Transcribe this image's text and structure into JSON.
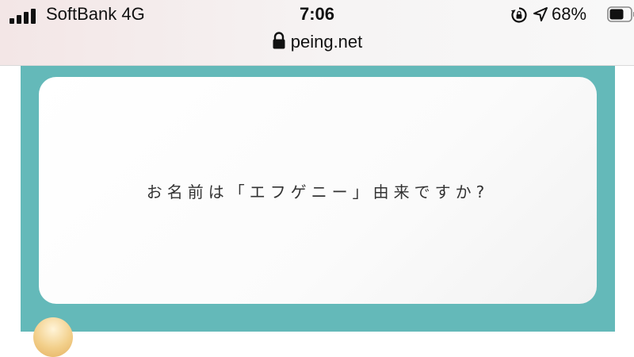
{
  "status_bar": {
    "carrier": "SoftBank 4G",
    "time": "7:06",
    "battery_percent": "68%",
    "battery_level": 0.68,
    "icons": [
      "signal-bars-icon",
      "rotation-lock-icon",
      "location-arrow-icon",
      "battery-icon"
    ]
  },
  "address_bar": {
    "url": "peing.net",
    "icon": "lock-icon"
  },
  "question": {
    "text": "お名前は「エフゲニー」由来ですか?"
  },
  "colors": {
    "frame": "#64b9b9",
    "card": "#ffffff",
    "status_bar": "#f5eeee"
  }
}
